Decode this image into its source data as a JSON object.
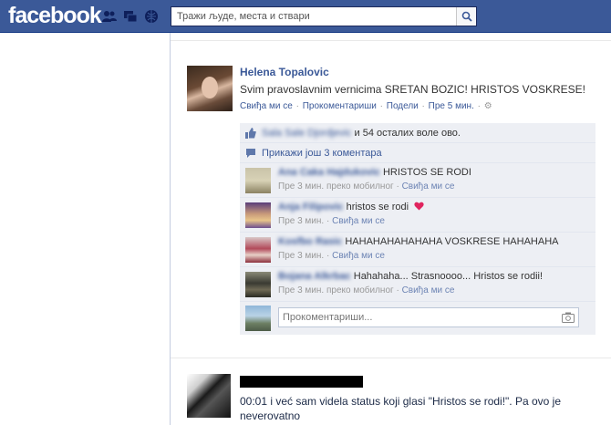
{
  "header": {
    "logo": "facebook",
    "search_placeholder": "Тражи људе, места и ствари",
    "icons": [
      "friend-requests-icon",
      "messages-icon",
      "notifications-icon",
      "search-icon"
    ]
  },
  "story": {
    "author": "Helena Topalovic",
    "message": "Svim pravoslavnim vernicima SRETAN BOZIC! HRISTOS VOSKRESE!",
    "actions": {
      "like": "Свиђа ми се",
      "comment": "Прокоментариши",
      "share": "Подели",
      "time": "Пре 5 мин."
    },
    "likes": {
      "blurred_name": "Sala Sale Djordjevic",
      "text": "и 54 осталих воле ово."
    },
    "view_more": "Прикажи још 3 коментара",
    "comments": [
      {
        "blurred_name": "Ana Caka Hajdukovic",
        "text": "HRISTOS SE RODI",
        "time": "Пре 3 мин.",
        "via": "преко мобилног",
        "like": "Свиђа ми се",
        "has_heart": false
      },
      {
        "blurred_name": "Anja Filipovic",
        "text": "hristos se rodi",
        "time": "Пре 3 мин.",
        "via": "",
        "like": "Свиђа ми се",
        "has_heart": true
      },
      {
        "blurred_name": "Kosfbo Rasic",
        "text": "HAHAHAHAHAHAHA VOSKRESE HAHAHAHA",
        "time": "Пре 3 мин.",
        "via": "",
        "like": "Свиђа ми се",
        "has_heart": false
      },
      {
        "blurred_name": "Bojana Alkrbac",
        "text": "Hahahaha... Strasnoooo... Hristos se rodii!",
        "time": "Пре 3 мин.",
        "via": "преко мобилног",
        "like": "Свиђа ми се",
        "has_heart": false
      }
    ],
    "composer_placeholder": "Прокоментариши..."
  },
  "story2": {
    "text": "00:01 i već sam videla status koji glasi \"Hristos se rodi!\". Pa ovo je neverovatno"
  },
  "colors": {
    "brand": "#3b5998",
    "link": "#3b5998",
    "ufi_bg": "#edeff4",
    "heart": "#e0245e"
  }
}
